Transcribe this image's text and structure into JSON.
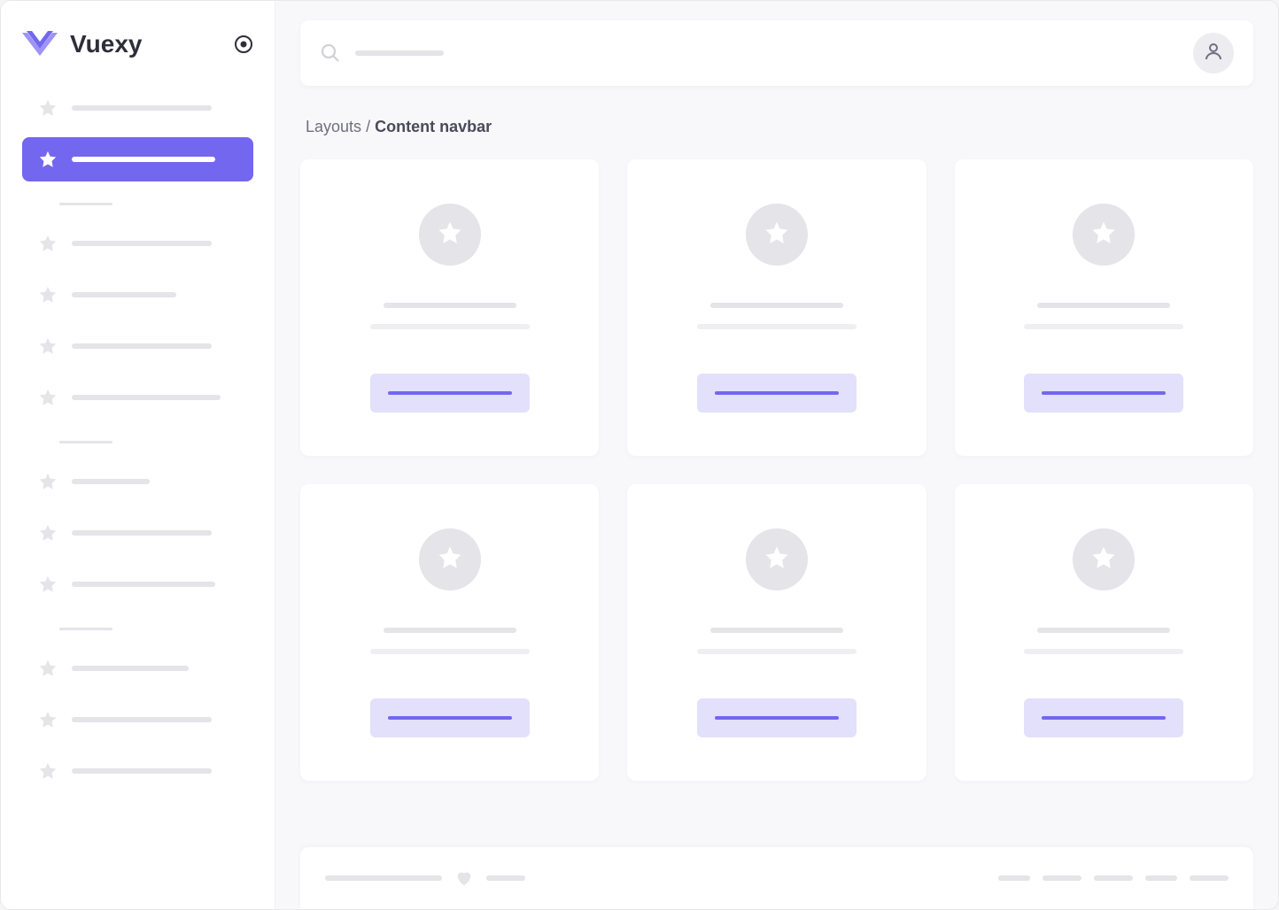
{
  "brand": {
    "name": "Vuexy"
  },
  "breadcrumb": {
    "parent": "Layouts",
    "separator": "/",
    "current": "Content navbar"
  },
  "colors": {
    "primary": "#7367f0",
    "primary_light": "#e3e0fb",
    "skeleton": "#e4e4e9"
  },
  "sidebar": {
    "groups": [
      {
        "head": false,
        "items": [
          {
            "active": false,
            "lw": 158
          },
          {
            "active": true,
            "lw": 162
          }
        ]
      },
      {
        "head": true,
        "items": [
          {
            "active": false,
            "lw": 158
          },
          {
            "active": false,
            "lw": 118
          },
          {
            "active": false,
            "lw": 158
          },
          {
            "active": false,
            "lw": 168
          }
        ]
      },
      {
        "head": true,
        "items": [
          {
            "active": false,
            "lw": 88
          },
          {
            "active": false,
            "lw": 158
          },
          {
            "active": false,
            "lw": 162
          }
        ]
      },
      {
        "head": true,
        "items": [
          {
            "active": false,
            "lw": 132
          },
          {
            "active": false,
            "lw": 158
          },
          {
            "active": false,
            "lw": 158
          }
        ]
      }
    ]
  },
  "cards": [
    {},
    {},
    {},
    {},
    {},
    {}
  ],
  "footer": {
    "left_lines": [
      132,
      44
    ],
    "right_lines": [
      36,
      44,
      44,
      36,
      44
    ]
  }
}
